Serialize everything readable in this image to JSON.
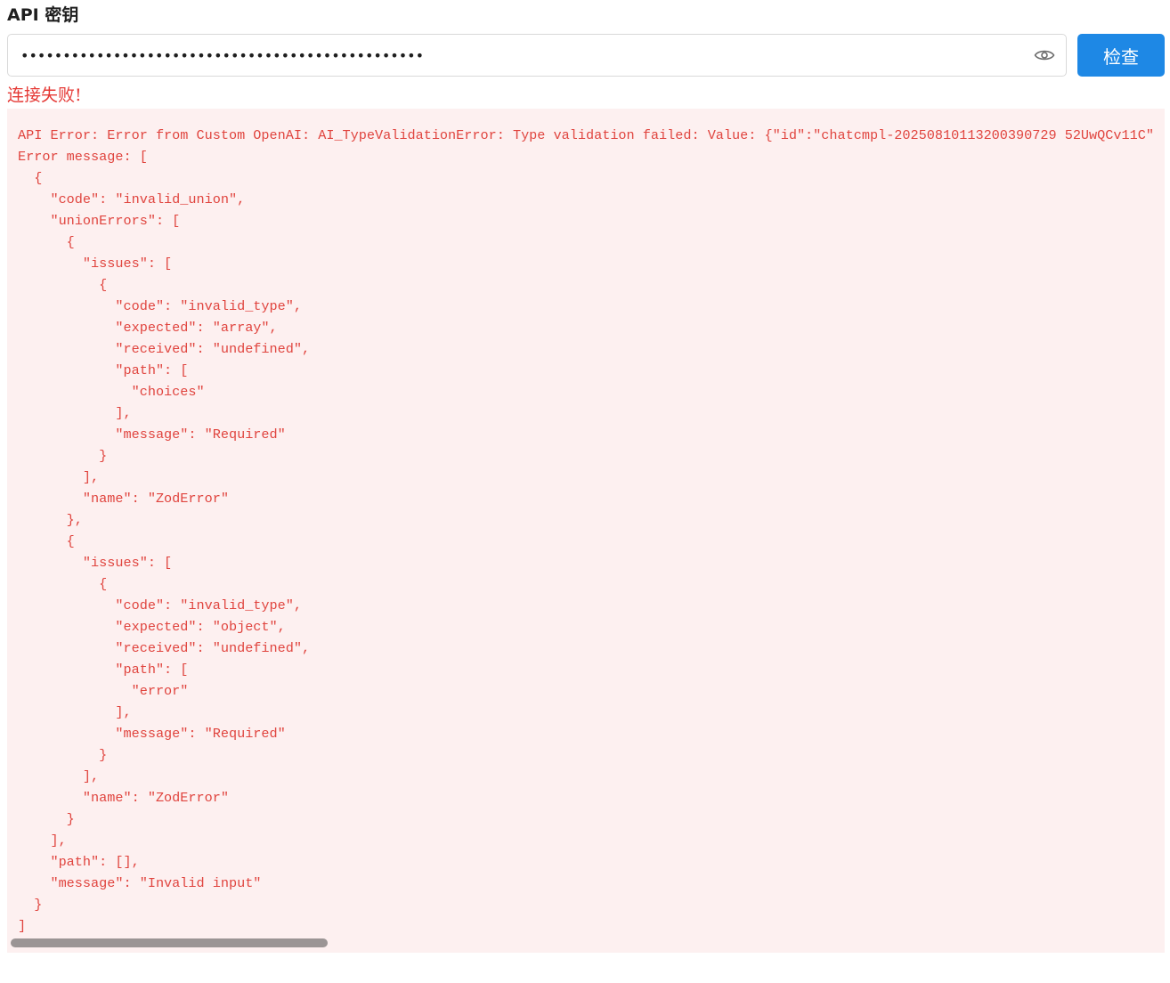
{
  "api_key": {
    "label": "API 密钥",
    "masked_value": "••••••••••••••••••••••••••••••••••••••••••••••••",
    "toggle_icon": "eye-icon",
    "check_button_label": "检查",
    "button_color": "#1e88e5"
  },
  "status": {
    "text": "连接失败!",
    "color": "#e53935"
  },
  "error_details": {
    "text": "API Error: Error from Custom OpenAI: AI_TypeValidationError: Type validation failed: Value: {\"id\":\"chatcmpl-20250810113200390729 52UwQCv11C\"\nError message: [\n  {\n    \"code\": \"invalid_union\",\n    \"unionErrors\": [\n      {\n        \"issues\": [\n          {\n            \"code\": \"invalid_type\",\n            \"expected\": \"array\",\n            \"received\": \"undefined\",\n            \"path\": [\n              \"choices\"\n            ],\n            \"message\": \"Required\"\n          }\n        ],\n        \"name\": \"ZodError\"\n      },\n      {\n        \"issues\": [\n          {\n            \"code\": \"invalid_type\",\n            \"expected\": \"object\",\n            \"received\": \"undefined\",\n            \"path\": [\n              \"error\"\n            ],\n            \"message\": \"Required\"\n          }\n        ],\n        \"name\": \"ZodError\"\n      }\n    ],\n    \"path\": [],\n    \"message\": \"Invalid input\"\n  }\n]",
    "background": "#fdf0f0",
    "text_color": "#e0443e"
  }
}
